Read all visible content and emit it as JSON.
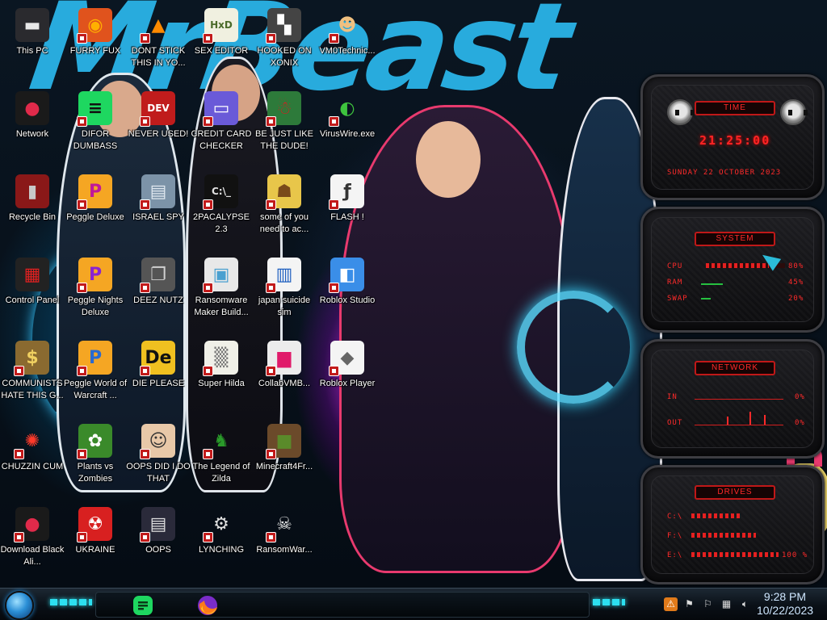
{
  "wallpaper": {
    "title_text": "MrBeast"
  },
  "desktop_icons": [
    {
      "label": "This PC",
      "icon": "computer-icon",
      "glyph": "▬",
      "color": "#e8e8e8",
      "bg": "#2a2a2e"
    },
    {
      "label": "FURRY FUX",
      "icon": "firefox-icon",
      "glyph": "◉",
      "color": "#ffb000",
      "bg": "#e0531d"
    },
    {
      "label": "DONT STICK THIS IN YO...",
      "icon": "vlc-cone-icon",
      "glyph": "▲",
      "color": "#ff8a00",
      "bg": "transparent"
    },
    {
      "label": "SEX EDITOR",
      "icon": "hex-editor-icon",
      "glyph": "HxD",
      "color": "#4b6b2a",
      "bg": "#f0f0e0"
    },
    {
      "label": "HOOKED ON XONIX",
      "icon": "xonix-game-icon",
      "glyph": "▚",
      "color": "#ffffff",
      "bg": "#444444"
    },
    {
      "label": "VM0Technic...",
      "icon": "doctor-icon",
      "glyph": "☻",
      "color": "#f0c080",
      "bg": "transparent"
    },
    {
      "label": "Network",
      "icon": "network-icon",
      "glyph": "●",
      "color": "#e02a4a",
      "bg": "#1a1a1a"
    },
    {
      "label": "DIFOR DUMBASS",
      "icon": "discord-like-icon",
      "glyph": "≡",
      "color": "#111",
      "bg": "#1ed760"
    },
    {
      "label": "NEVER USED!",
      "icon": "dev-cpp-icon",
      "glyph": "DEV",
      "color": "#ffffff",
      "bg": "#c01c1c"
    },
    {
      "label": "CREDIT CARD CHECKER",
      "icon": "credit-card-icon",
      "glyph": "▭",
      "color": "#ffffff",
      "bg": "#6a5ad8"
    },
    {
      "label": "BE JUST LIKE THE DUDE!",
      "icon": "santa-icon",
      "glyph": "☃",
      "color": "#c22",
      "bg": "#2d7a3a"
    },
    {
      "label": "VirusWire.exe",
      "icon": "limewire-icon",
      "glyph": "◐",
      "color": "#3ec43e",
      "bg": "transparent"
    },
    {
      "label": "Recycle Bin",
      "icon": "recycle-bin-icon",
      "glyph": "▮",
      "color": "#c8c8c8",
      "bg": "#8a1818"
    },
    {
      "label": "Peggle Deluxe",
      "icon": "peggle-icon",
      "glyph": "P",
      "color": "#c0179a",
      "bg": "#f5a623"
    },
    {
      "label": "ISRAEL SPY",
      "icon": "spy-folder-icon",
      "glyph": "▤",
      "color": "#e0e8f0",
      "bg": "#7c93a8"
    },
    {
      "label": "2PACALYPSE 2.3",
      "icon": "terminal-icon",
      "glyph": "C:\\_",
      "color": "#e0e0e0",
      "bg": "#111111"
    },
    {
      "label": "some of you need to ac...",
      "icon": "beaver-icon",
      "glyph": "☗",
      "color": "#7a4a1a",
      "bg": "#e8c64a"
    },
    {
      "label": "FLASH !",
      "icon": "flash-icon",
      "glyph": "ƒ",
      "color": "#333",
      "bg": "#f4f4f4"
    },
    {
      "label": "Control Panel",
      "icon": "control-panel-icon",
      "glyph": "▦",
      "color": "#e02020",
      "bg": "#222"
    },
    {
      "label": "Peggle Nights Deluxe",
      "icon": "peggle-nights-icon",
      "glyph": "P",
      "color": "#8a23d0",
      "bg": "#f5a623"
    },
    {
      "label": "DEEZ NUTZ",
      "icon": "window-stack-icon",
      "glyph": "❐",
      "color": "#d0d0d0",
      "bg": "#555"
    },
    {
      "label": "Ransomware Maker Build...",
      "icon": "app-window-icon",
      "glyph": "▣",
      "color": "#4aa0d0",
      "bg": "#e8e8e8"
    },
    {
      "label": "japan suicide sim",
      "icon": "document-icon",
      "glyph": "▥",
      "color": "#2060c0",
      "bg": "#f4f4f4"
    },
    {
      "label": "Roblox Studio",
      "icon": "roblox-studio-icon",
      "glyph": "◧",
      "color": "#ffffff",
      "bg": "#3a8ee8"
    },
    {
      "label": "COMMUNISTS HATE THIS G...",
      "icon": "money-bag-icon",
      "glyph": "$",
      "color": "#f0d060",
      "bg": "#8a6a30"
    },
    {
      "label": "Peggle World of Warcraft ...",
      "icon": "peggle-wow-icon",
      "glyph": "P",
      "color": "#2a6ad0",
      "bg": "#f5a623"
    },
    {
      "label": "DIE PLEASE",
      "icon": "de-app-icon",
      "glyph": "De",
      "color": "#111",
      "bg": "#f0c020"
    },
    {
      "label": "Super Hilda",
      "icon": "pixel-sprite-icon",
      "glyph": "▒",
      "color": "#777",
      "bg": "#f0f0e8"
    },
    {
      "label": "CollabVMB...",
      "icon": "collabvm-icon",
      "glyph": "▆",
      "color": "#e01a6a",
      "bg": "#ececec"
    },
    {
      "label": "Roblox Player",
      "icon": "roblox-icon",
      "glyph": "◆",
      "color": "#666",
      "bg": "#f4f4f4"
    },
    {
      "label": "CHUZZIN CUM",
      "icon": "chuzzle-icon",
      "glyph": "✺",
      "color": "#ff3a2a",
      "bg": "transparent"
    },
    {
      "label": "Plants vs Zombies",
      "icon": "pvz-flower-icon",
      "glyph": "✿",
      "color": "#ffffff",
      "bg": "#3a8a2a"
    },
    {
      "label": "OOPS DID I DO THAT",
      "icon": "portrait-icon",
      "glyph": "☺",
      "color": "#333",
      "bg": "#e8c8a8"
    },
    {
      "label": "The Legend of Zilda",
      "icon": "link-sprite-icon",
      "glyph": "♞",
      "color": "#2a9a2a",
      "bg": "transparent"
    },
    {
      "label": "Minecraft4Fr...",
      "icon": "minecraft-block-icon",
      "glyph": "■",
      "color": "#5a8a2a",
      "bg": "#6b4a2a"
    },
    {
      "label": "Download Black Ali...",
      "icon": "alienware-icon",
      "glyph": "●",
      "color": "#e02a4a",
      "bg": "#1a1a1a"
    },
    {
      "label": "UKRAINE",
      "icon": "radiation-icon",
      "glyph": "☢",
      "color": "#ffffff",
      "bg": "#d82020"
    },
    {
      "label": "OOPS",
      "icon": "book-icon",
      "glyph": "▤",
      "color": "#e0e0e0",
      "bg": "#2a2a3a"
    },
    {
      "label": "LYNCHING",
      "icon": "tool-icon",
      "glyph": "⚙",
      "color": "#e0e0e0",
      "bg": "transparent"
    },
    {
      "label": "RansomWar...",
      "icon": "skull-icon",
      "glyph": "☠",
      "color": "#f0f0f0",
      "bg": "transparent"
    }
  ],
  "gadget": {
    "time_panel": {
      "title": "TIME",
      "time": "21:25:00",
      "date": "SUNDAY 22 OCTOBER 2023"
    },
    "system_panel": {
      "title": "SYSTEM",
      "cpu_label": "CPU",
      "cpu_value": "80%",
      "ram_label": "RAM",
      "ram_value": "45%",
      "swap_label": "SWAP",
      "swap_value": "20%",
      "cpu_level": 0.8,
      "ram_level": 0.45,
      "swap_level": 0.2
    },
    "network_panel": {
      "title": "NETWORK",
      "in_label": "IN",
      "in_value": "0%",
      "out_label": "OUT",
      "out_value": "0%"
    },
    "drives_panel": {
      "title": "DRIVES",
      "drives": [
        {
          "label": "C:\\",
          "value": ""
        },
        {
          "label": "F:\\",
          "value": ""
        },
        {
          "label": "E:\\",
          "value": "100 %"
        }
      ]
    },
    "accent_color": "#ff2a2a"
  },
  "taskbar": {
    "pinned_apps": [
      {
        "name": "spotify-like-app",
        "icon": "green-app-icon"
      },
      {
        "name": "firefox",
        "icon": "firefox-icon"
      }
    ],
    "tray_icons": [
      "alert-app-icon",
      "hidden-icons-chevron",
      "flag-icon",
      "network-icon",
      "volume-icon"
    ],
    "clock_time": "9:28 PM",
    "clock_date": "10/22/2023"
  }
}
